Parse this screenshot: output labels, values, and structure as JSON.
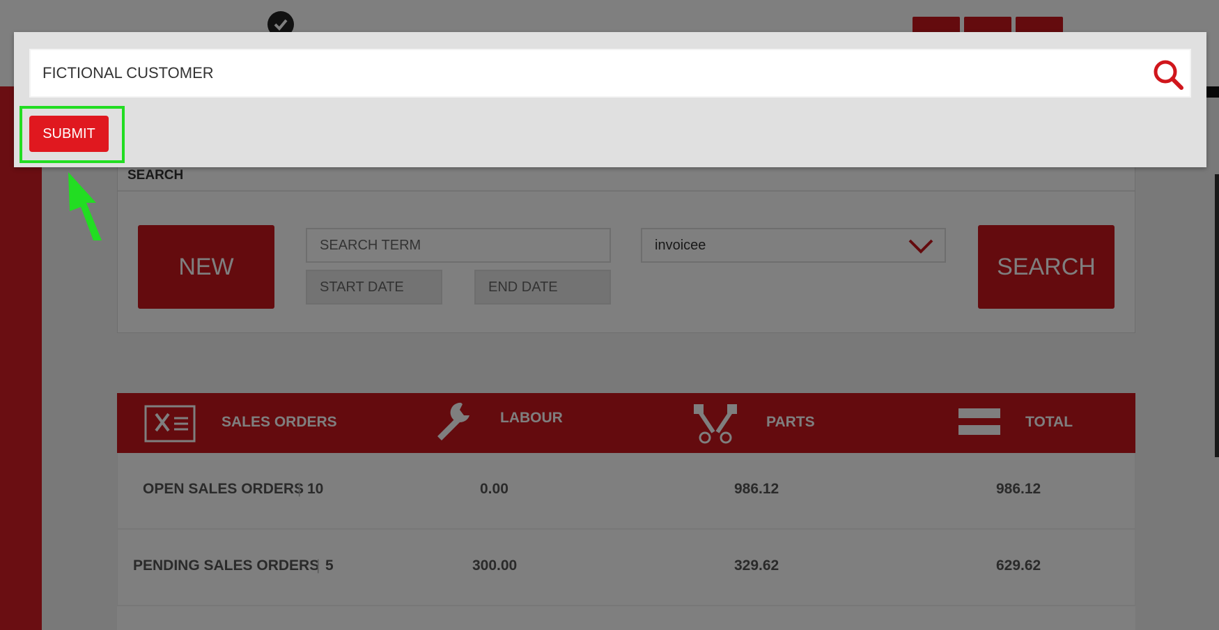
{
  "modal": {
    "search_value": "FICTIONAL CUSTOMER",
    "submit_label": "SUBMIT"
  },
  "search_panel": {
    "heading": "SEARCH",
    "new_label": "NEW",
    "search_term_placeholder": "SEARCH TERM",
    "start_date_placeholder": "START DATE",
    "end_date_placeholder": "END DATE",
    "type_select_value": "invoicee",
    "search_label": "SEARCH"
  },
  "summary": {
    "headers": [
      "SALES ORDERS",
      "LABOUR",
      "PARTS",
      "TOTAL"
    ],
    "rows": [
      {
        "label": "OPEN SALES ORDERS",
        "count": "10",
        "labour": "0.00",
        "parts": "986.12",
        "total": "986.12"
      },
      {
        "label": "PENDING SALES ORDERS",
        "count": "5",
        "labour": "300.00",
        "parts": "329.62",
        "total": "629.62"
      }
    ]
  },
  "colors": {
    "brand_red": "#c8161c",
    "submit_red": "#e0181f",
    "highlight_green": "#22dd22"
  },
  "icons": [
    "check-icon",
    "home-icon",
    "gear-icon",
    "logout-icon",
    "search-icon",
    "chevron-down-icon",
    "sales-orders-icon",
    "wrench-icon",
    "pistons-icon",
    "equals-icon",
    "pointer-arrow-icon"
  ]
}
